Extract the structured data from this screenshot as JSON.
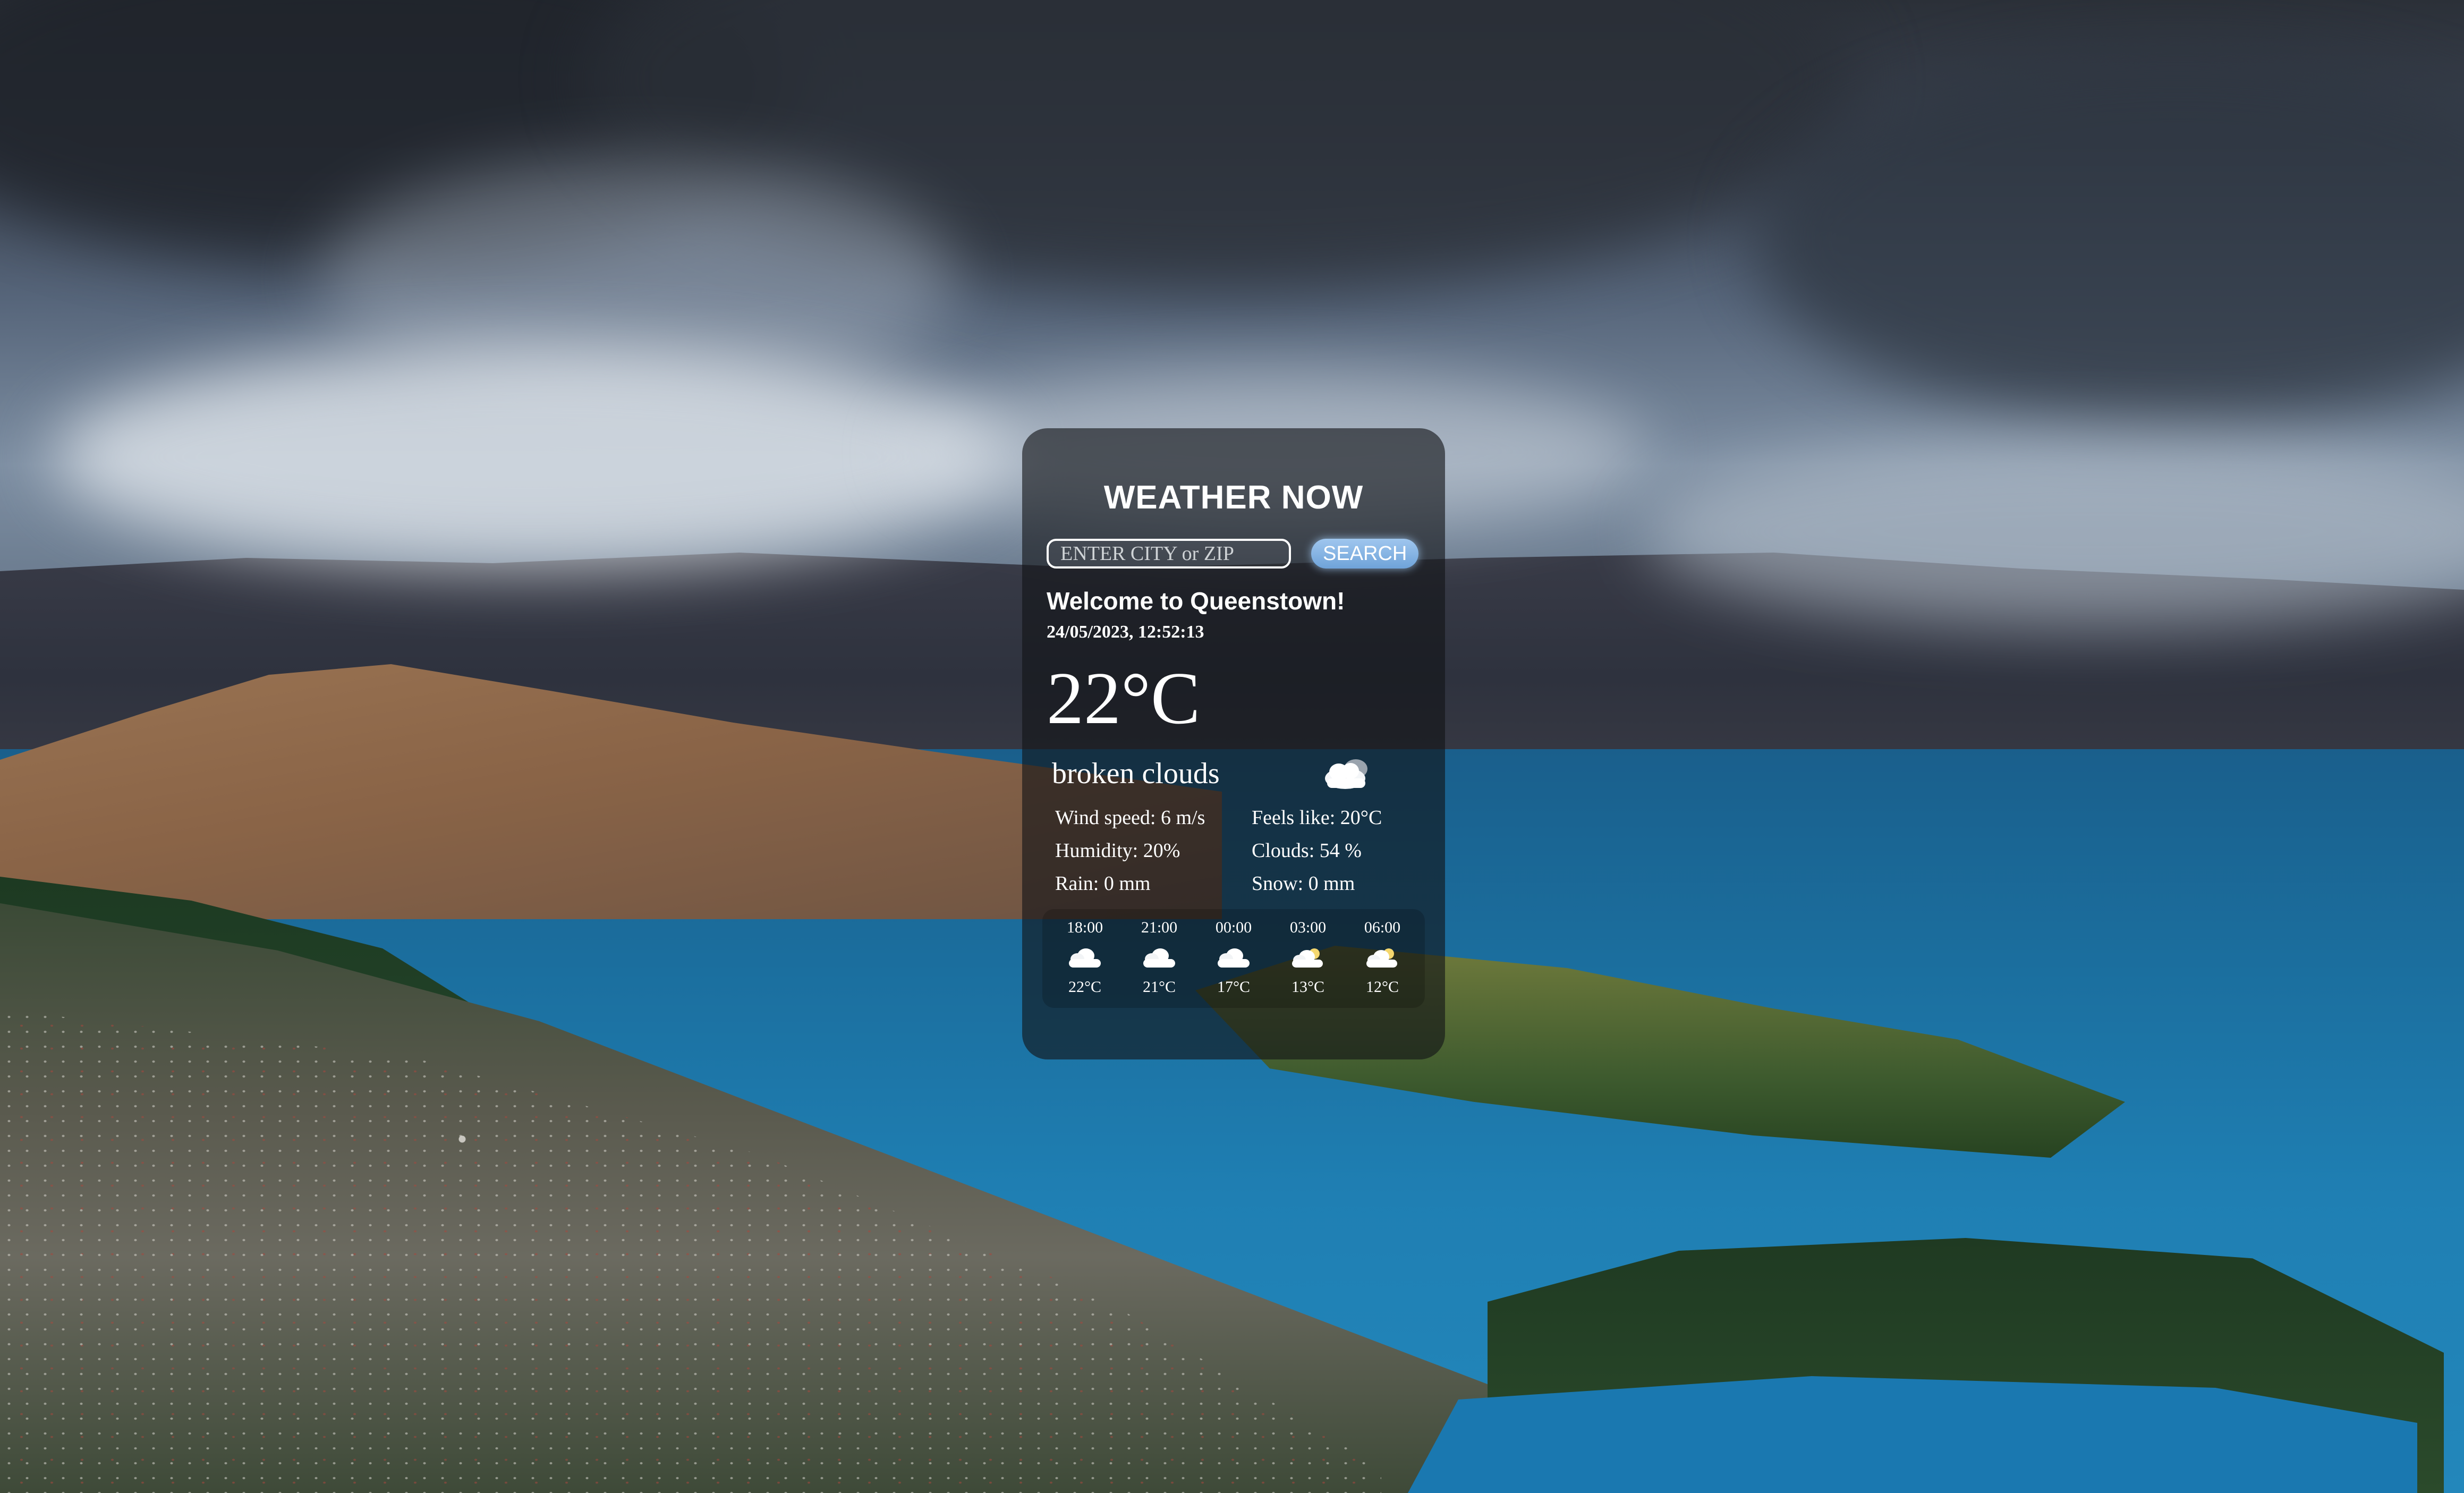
{
  "app": {
    "title": "WEATHER NOW"
  },
  "search": {
    "placeholder": "ENTER CITY or ZIP",
    "value": "",
    "button_label": "SEARCH"
  },
  "current": {
    "welcome": "Welcome to Queenstown!",
    "datetime": "24/05/2023, 12:52:13",
    "temperature": "22°C",
    "condition": "broken clouds",
    "condition_icon": "broken-clouds-icon",
    "details": {
      "wind": "Wind speed: 6 m/s",
      "feels_like": "Feels like: 20°C",
      "humidity": "Humidity: 20%",
      "clouds": "Clouds: 54 %",
      "rain": "Rain: 0 mm",
      "snow": "Snow: 0 mm"
    }
  },
  "forecast": [
    {
      "time": "18:00",
      "icon": "cloud-icon",
      "temp": "22°C"
    },
    {
      "time": "21:00",
      "icon": "cloud-icon",
      "temp": "21°C"
    },
    {
      "time": "00:00",
      "icon": "cloud-icon",
      "temp": "17°C"
    },
    {
      "time": "03:00",
      "icon": "partly-cloudy-icon",
      "temp": "13°C"
    },
    {
      "time": "06:00",
      "icon": "partly-cloudy-icon",
      "temp": "12°C"
    }
  ],
  "colors": {
    "card_background": "#121416",
    "button_accent": "#6fa3d9",
    "text": "#ffffff"
  }
}
